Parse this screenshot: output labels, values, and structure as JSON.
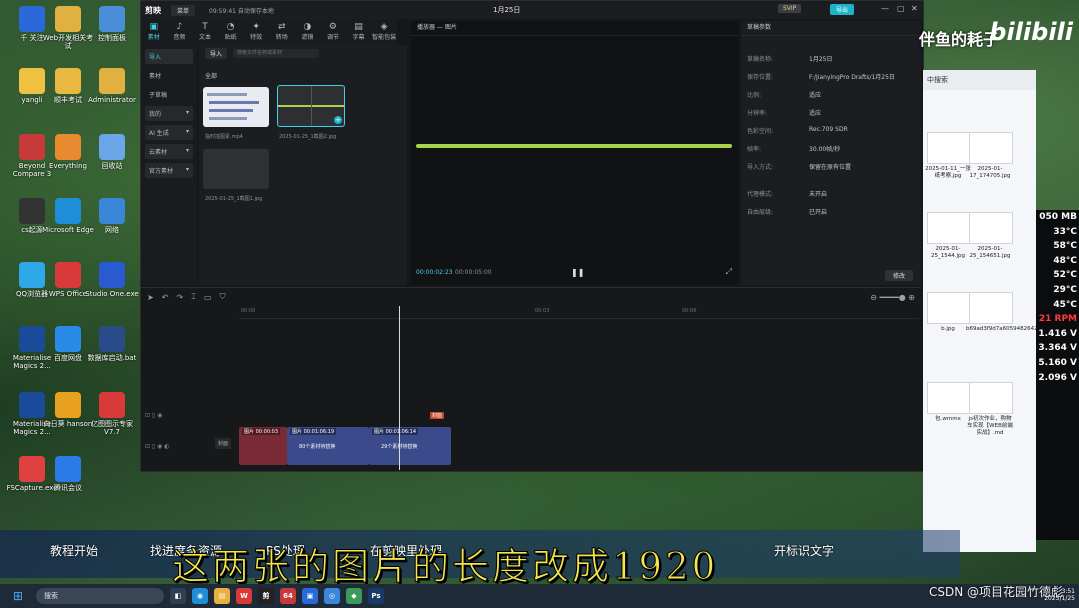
{
  "desktop_icons": [
    {
      "label": "千 关注",
      "color": "#2a6ad8"
    },
    {
      "label": "Web开发相关考试",
      "color": "#e0b040"
    },
    {
      "label": "控制面板",
      "color": "#4a8ed8"
    },
    {
      "label": "yangli",
      "color": "#f0c040"
    },
    {
      "label": "顺丰考试",
      "color": "#e8b840"
    },
    {
      "label": "Administrator",
      "color": "#e0b040"
    },
    {
      "label": "Beyond Compare 3",
      "color": "#c83a3a"
    },
    {
      "label": "Everything",
      "color": "#e88a30"
    },
    {
      "label": "回收站",
      "color": "#6aa6e8"
    },
    {
      "label": "cs起源",
      "color": "#333333"
    },
    {
      "label": "Microsoft Edge",
      "color": "#1f8ed8"
    },
    {
      "label": "网络",
      "color": "#3a86d8"
    },
    {
      "label": "QQ浏览器",
      "color": "#2fa8e8"
    },
    {
      "label": "WPS Office",
      "color": "#d83a3a"
    },
    {
      "label": "Studio One.exe",
      "color": "#2a5ad0"
    },
    {
      "label": "Materialise Magics 2...",
      "color": "#1a4a9a"
    },
    {
      "label": "百度网盘",
      "color": "#2a8ae8"
    },
    {
      "label": "数据库启动.bat",
      "color": "#2a4a8a"
    },
    {
      "label": "Materialise Magics 2...",
      "color": "#1a4a9a"
    },
    {
      "label": "向日葵 hanson",
      "color": "#e8a020"
    },
    {
      "label": "亿图图示专家V7.7",
      "color": "#d83a3a"
    },
    {
      "label": "FSCapture.exe",
      "color": "#e04040"
    },
    {
      "label": "腾讯会议",
      "color": "#2a7ae8"
    }
  ],
  "editor": {
    "app_name": "剪映",
    "menu_label": "菜单",
    "autosave": "09:59:41 自动保存本地",
    "project_title": "1月25日",
    "svip_label": "SVIP",
    "export_label": "导出",
    "toolbar": [
      {
        "label": "素材",
        "icon": "▣",
        "active": true
      },
      {
        "label": "音频",
        "icon": "♪"
      },
      {
        "label": "文本",
        "icon": "T"
      },
      {
        "label": "贴纸",
        "icon": "◔"
      },
      {
        "label": "特效",
        "icon": "✦"
      },
      {
        "label": "转场",
        "icon": "⇄"
      },
      {
        "label": "滤镜",
        "icon": "◑"
      },
      {
        "label": "调节",
        "icon": "⚙"
      },
      {
        "label": "字幕",
        "icon": "▤"
      },
      {
        "label": "智能包装",
        "icon": "◈"
      }
    ],
    "left_nav": [
      {
        "label": "导入",
        "state": "on"
      },
      {
        "label": "素材",
        "state": "plain"
      },
      {
        "label": "子草稿",
        "state": "plain"
      },
      {
        "label": "我的",
        "state": "drop"
      },
      {
        "label": "AI 生成",
        "state": "drop"
      },
      {
        "label": "云素材",
        "state": "drop"
      },
      {
        "label": "官方素材",
        "state": "drop"
      }
    ],
    "media": {
      "import_label": "导入",
      "search_placeholder": "搜索文件名称或素材",
      "all_label": "全部",
      "items": [
        {
          "name": "临时插图素.mp4"
        },
        {
          "name": "2025-01-25_1截图2.jpg"
        },
        {
          "name": "2025-01-25_1截图1.jpg"
        }
      ]
    },
    "preview": {
      "title": "播放器 — 图片",
      "current_time": "00:00:02:23",
      "total_time": "00:00:05:00"
    },
    "properties": {
      "title": "草稿参数",
      "rows": [
        {
          "k": "草稿名称:",
          "v": "1月25日"
        },
        {
          "k": "保存位置:",
          "v": "F:/JianyingPro Drafts/1月25日"
        },
        {
          "k": "比例:",
          "v": "适应"
        },
        {
          "k": "分辨率:",
          "v": "适应"
        },
        {
          "k": "色彩空间:",
          "v": "Rec.709 SDR"
        },
        {
          "k": "帧率:",
          "v": "30.00帧/秒"
        },
        {
          "k": "导入方式:",
          "v": "保留在原有位置"
        },
        {
          "k": "代理模式:",
          "v": "未开启"
        },
        {
          "k": "自由层级:",
          "v": "已开启"
        }
      ],
      "modify_label": "修改"
    },
    "timeline": {
      "ruler": [
        "00:00",
        "00:03",
        "00:06"
      ],
      "cover_label": "封面",
      "clips": [
        {
          "label": "图片 00:00:03",
          "color": "#7a2a34"
        },
        {
          "label": "图片 00:01:06:19",
          "sub": "80个素材待替换",
          "color": "#3a4a8a"
        },
        {
          "label": "图片 00:01:06:14",
          "sub": "29个素材待替换",
          "color": "#3a4a8a"
        }
      ]
    }
  },
  "explorer": {
    "title": "中搜索",
    "files": [
      {
        "name": "2025-01-11_一张纸考察.jpg"
      },
      {
        "name": "2025-01-17_174705.jpg"
      },
      {
        "name": "2025-01-25_1544.jpg"
      },
      {
        "name": "2025-01-25_154651.jpg"
      },
      {
        "name": "b.jpg"
      },
      {
        "name": "b69ad3f9d7a605948264296e34349b023bba9d.jpg"
      },
      {
        "name": "包.wmmx"
      },
      {
        "name": "js初次作业，购物车实现【WEB前端实战】.md"
      }
    ]
  },
  "monitor": {
    "values": [
      "050 MB",
      "33°C",
      "58°C",
      "48°C",
      "52°C",
      "29°C",
      "45°C",
      "21 RPM",
      "1.416 V",
      "3.364 V",
      "5.160 V",
      "2.096 V"
    ],
    "colors": [
      "#ffffff",
      "#ffffff",
      "#ffffff",
      "#ffffff",
      "#ffffff",
      "#ffffff",
      "#ffffff",
      "#ff3a3a",
      "#ffffff",
      "#ffffff",
      "#ffffff",
      "#ffffff"
    ]
  },
  "overlay": {
    "uploader": "伴鱼的耗子",
    "site_logo": "bilibili",
    "segments": [
      "教程开始",
      "找进度条资源",
      "PS处理",
      "在剪映里处理",
      "开标识文字"
    ],
    "caption": "这两张的图片的长度改成1920",
    "watermark": "CSDN @项目花园竹德彪"
  },
  "taskbar": {
    "search_placeholder": "搜索",
    "apps": [
      {
        "label": "◧",
        "color": "#2f3e52"
      },
      {
        "label": "◉",
        "color": "#1f8ed8"
      },
      {
        "label": "▤",
        "color": "#e8b040"
      },
      {
        "label": "W",
        "color": "#d83a3a"
      },
      {
        "label": "剪",
        "color": "#222222"
      },
      {
        "label": "64",
        "color": "#c83a3a"
      },
      {
        "label": "▣",
        "color": "#2a6ad8"
      },
      {
        "label": "◎",
        "color": "#3a86d8"
      },
      {
        "label": "◆",
        "color": "#3a9a5a"
      },
      {
        "label": "Ps",
        "color": "#1a3a6a"
      }
    ],
    "time": "3:51",
    "date": "2025/1/25"
  }
}
